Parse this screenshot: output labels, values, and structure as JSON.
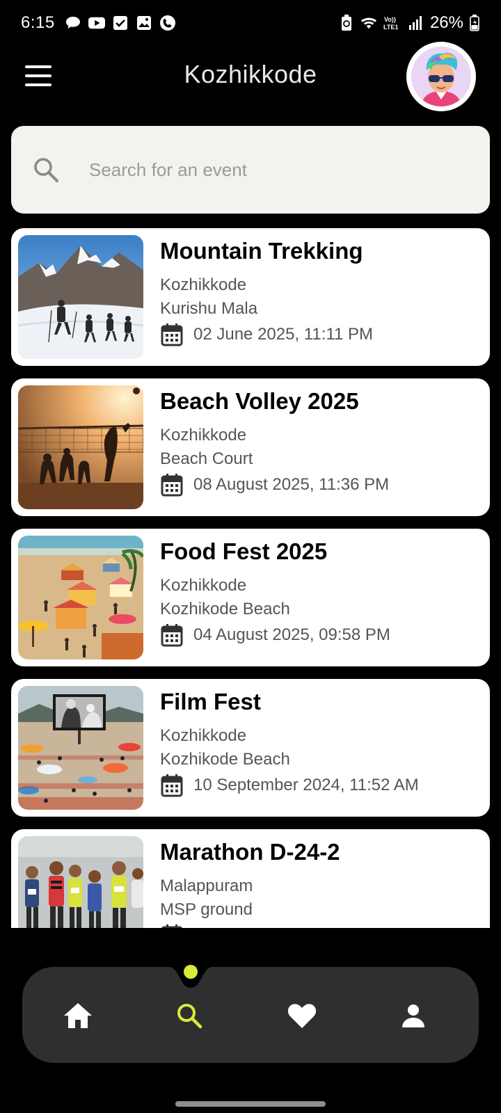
{
  "status_bar": {
    "time": "6:15",
    "battery": "26%",
    "network": "LTE1"
  },
  "header": {
    "title": "Kozhikkode"
  },
  "search": {
    "placeholder": "Search for an event"
  },
  "events": [
    {
      "title": "Mountain Trekking",
      "city": "Kozhikkode",
      "venue": "Kurishu Mala",
      "date": "02 June 2025, 11:11 PM"
    },
    {
      "title": "Beach Volley 2025",
      "city": "Kozhikkode",
      "venue": "Beach Court",
      "date": "08 August 2025, 11:36 PM"
    },
    {
      "title": "Food Fest 2025",
      "city": "Kozhikkode",
      "venue": "Kozhikode Beach",
      "date": "04 August 2025, 09:58 PM"
    },
    {
      "title": "Film Fest",
      "city": "Kozhikkode",
      "venue": "Kozhikode Beach",
      "date": "10 September 2024, 11:52 AM"
    },
    {
      "title": "Marathon D-24-2",
      "city": "Malappuram",
      "venue": "MSP ground",
      "date": ""
    }
  ],
  "nav": {
    "active": "search",
    "active_color": "#d8ea3a",
    "items": [
      "home-icon",
      "search-icon",
      "heart-icon",
      "person-icon"
    ]
  },
  "colors": {
    "background": "#000000",
    "card": "#ffffff",
    "search_bg": "#f3f2ee",
    "nav_bg": "#2f2f2f"
  }
}
